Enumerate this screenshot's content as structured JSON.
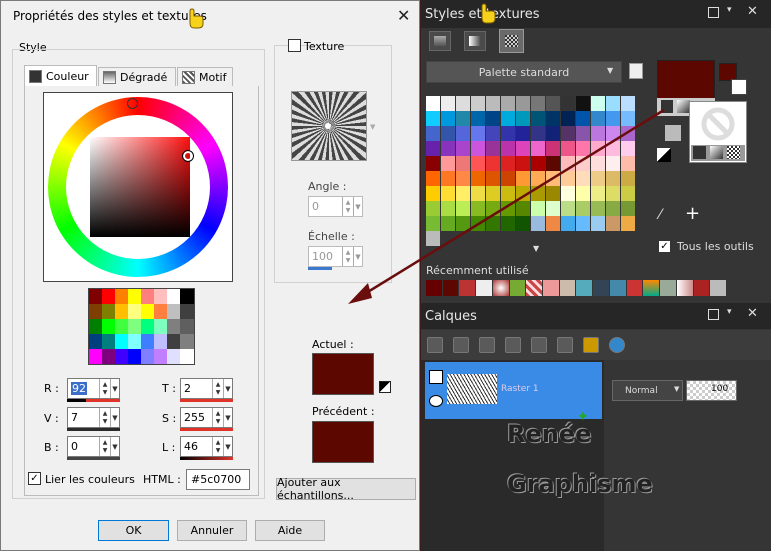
{
  "dialog": {
    "title": "Propriétés des styles et textures",
    "close_glyph": "✕",
    "style_label": "Style",
    "texture_label": "Texture",
    "tabs": [
      {
        "label": "Couleur"
      },
      {
        "label": "Dégradé"
      },
      {
        "label": "Motif"
      }
    ],
    "fields": {
      "r": {
        "label": "R :",
        "value": "92"
      },
      "v": {
        "label": "V :",
        "value": "7"
      },
      "b": {
        "label": "B :",
        "value": "0"
      },
      "t": {
        "label": "T :",
        "value": "2"
      },
      "s": {
        "label": "S :",
        "value": "255"
      },
      "l": {
        "label": "L :",
        "value": "46"
      }
    },
    "lier_label": "Lier les couleurs",
    "html_label": "HTML :",
    "html_value": "#5c0700",
    "angle_label": "Angle :",
    "angle_value": "0",
    "echelle_label": "Échelle :",
    "echelle_value": "100",
    "actuel_label": "Actuel :",
    "precedent_label": "Précédent :",
    "current_color": "#5c0700",
    "add_button": "Ajouter aux échantillons...",
    "ok": "OK",
    "cancel": "Annuler",
    "help": "Aide"
  },
  "styles_panel": {
    "title": "Styles et textures",
    "palette_select": "Palette standard",
    "tous_outils": "Tous les outils",
    "recent_label": "Récemment utilisé",
    "fg_color": "#5c0700",
    "bg_color": "#ffffff"
  },
  "layers_panel": {
    "title": "Calques",
    "layer_name": "Raster 1",
    "blend_mode": "Normal",
    "opacity": "100"
  },
  "watermark": {
    "line1": "Renée",
    "line2": "Graphisme"
  }
}
